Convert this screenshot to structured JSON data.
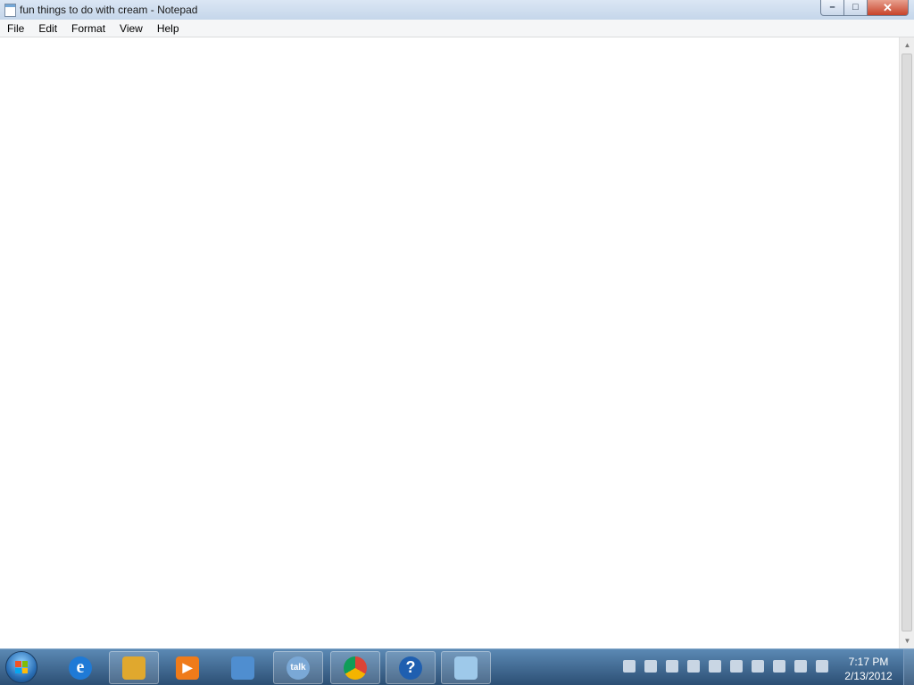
{
  "window": {
    "title": "fun things to do with cream - Notepad",
    "buttons": {
      "minimize": "–",
      "maximize": "□",
      "close": "✕"
    }
  },
  "menu": {
    "items": [
      "File",
      "Edit",
      "Format",
      "View",
      "Help"
    ]
  },
  "scrollbar": {
    "up_arrow": "▲",
    "down_arrow": "▼"
  },
  "taskbar": {
    "icons": [
      {
        "name": "start-orb",
        "color": "#2a6fb6"
      },
      {
        "name": "internet-explorer-icon",
        "color": "#1f7ad6",
        "glyph": "e"
      },
      {
        "name": "windows-explorer-icon",
        "color": "#e0a82e"
      },
      {
        "name": "media-player-icon",
        "color": "#ef7b1a",
        "glyph": "▶"
      },
      {
        "name": "paint-icon",
        "color": "#4f8ed0"
      },
      {
        "name": "google-talk-icon",
        "color": "#7aa8d6",
        "glyph": "talk"
      },
      {
        "name": "chrome-icon",
        "color": "#db4437"
      },
      {
        "name": "help-icon",
        "color": "#1f5fb0",
        "glyph": "?"
      },
      {
        "name": "notepad-icon",
        "color": "#9ec9ea"
      }
    ],
    "clock": {
      "time": "7:17 PM",
      "date": "2/13/2012"
    }
  }
}
